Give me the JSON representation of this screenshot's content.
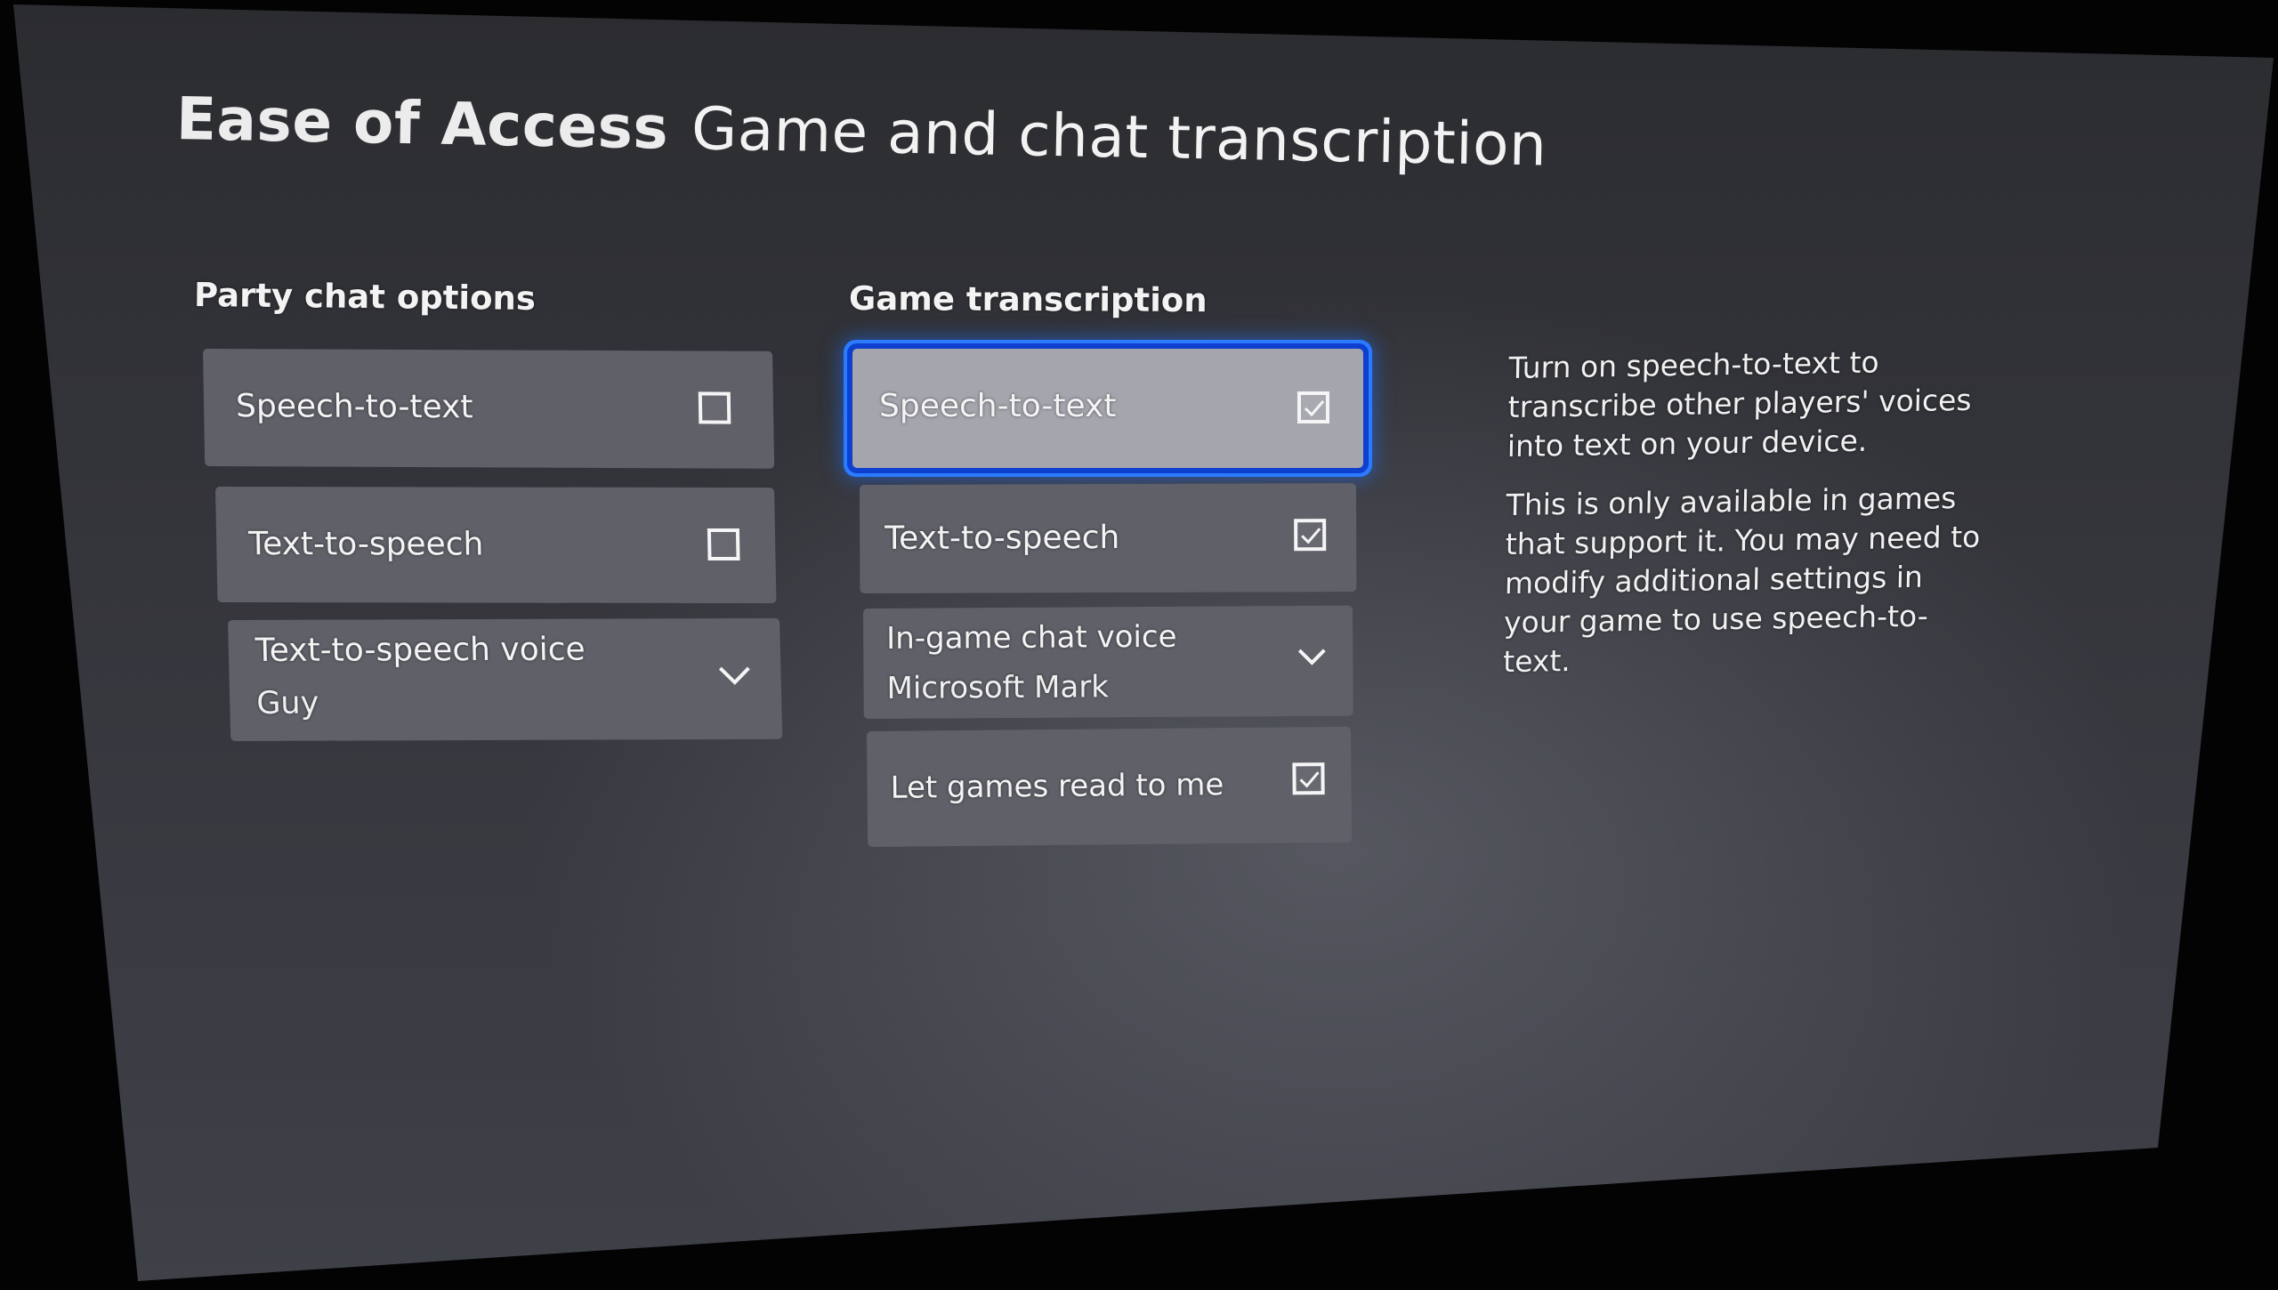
{
  "header": {
    "section": "Ease of Access",
    "page_title": "Game and chat transcription"
  },
  "party_chat": {
    "heading": "Party chat options",
    "items": [
      {
        "type": "checkbox",
        "label": "Speech-to-text",
        "checked": false
      },
      {
        "type": "checkbox",
        "label": "Text-to-speech",
        "checked": false
      },
      {
        "type": "dropdown",
        "label": "Text-to-speech voice",
        "value": "Guy",
        "icon": "chevron-down-icon"
      }
    ]
  },
  "game_transcription": {
    "heading": "Game transcription",
    "items": [
      {
        "type": "checkbox",
        "label": "Speech-to-text",
        "checked": true,
        "focused": true
      },
      {
        "type": "checkbox",
        "label": "Text-to-speech",
        "checked": true
      },
      {
        "type": "dropdown",
        "label": "In-game chat voice",
        "value": "Microsoft Mark",
        "icon": "chevron-down-icon"
      },
      {
        "type": "checkbox",
        "label": "Let games read to me",
        "checked": true
      }
    ]
  },
  "description": {
    "paragraphs": [
      "Turn on speech-to-text to transcribe other players' voices into text on your device.",
      "This is only available in games that support it. You may need to modify additional settings in your game to use speech-to-text."
    ]
  },
  "colors": {
    "focus_ring": "#2b7bff",
    "card": "#5f6068",
    "card_focused": "#a4a5ad",
    "background": "#35363c"
  }
}
